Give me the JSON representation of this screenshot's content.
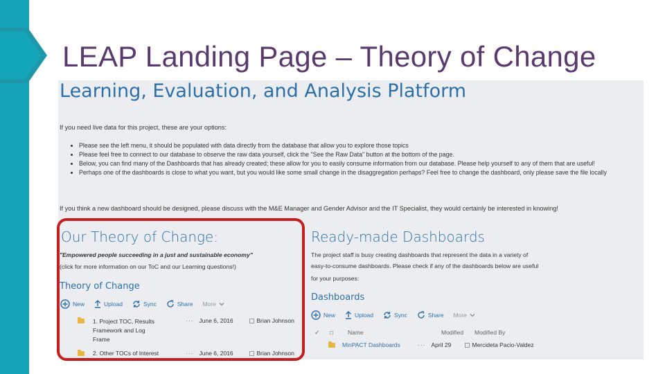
{
  "slide": {
    "title": "LEAP Landing Page – Theory of Change",
    "accent_color": "#14a3b5",
    "title_color": "#5a3a6e",
    "highlight_color": "#c41e1e"
  },
  "page": {
    "platform_title": "Learning, Evaluation, and Analysis Platform",
    "intro": "If you need live data for this project, these are your options:",
    "options": [
      "Please see the left menu, it should be populated with data directly from the database that allow you to explore those topics",
      "Please feel free to connect to our database to observe the raw data yourself, click the \"See the Raw Data\" button at the bottom of the page.",
      "Below, you can find many of the Dashboards that has already created; these allow for you to easily consume information from our database. Please help yourself to any of them that are useful!",
      "Perhaps one of the dashboards is close to what you want, but you would like some small change in the disaggregation perhaps? Feel free to change the dashboard, only please save the file locally"
    ],
    "note": "If you think a new dashboard should be designed, please discuss with the M&E Manager and Gender Advisor and the IT Specialist, they would certainly be interested in knowing!"
  },
  "toc": {
    "heading": "Our Theory of Change:",
    "quote": "\"Empowered people succeeding in a just and sustainable economy\"",
    "more_info": "(click for more information on our ToC and our Learning questions!)",
    "library_title": "Theory of Change",
    "toolbar": {
      "new": "New",
      "upload": "Upload",
      "sync": "Sync",
      "share": "Share",
      "more": "More"
    },
    "files": [
      {
        "name_line1": "1. Project TOC, Results",
        "name_line2": "Framework and Log",
        "name_line3": "Frame",
        "modified": "June 6, 2016",
        "modified_by": "Brian Johnson"
      },
      {
        "name_line1": "2. Other TOCs of Interest",
        "modified": "June 6, 2016",
        "modified_by": "Brian Johnson"
      }
    ]
  },
  "dashboards": {
    "heading": "Ready-made Dashboards",
    "desc_line1": "The project staff is busy creating dashboards that represent the data in a variety of",
    "desc_line2": "easy-to-consume dashboards. Please check if any of the dashboards below are useful",
    "desc_line3": "for your purposes:",
    "library_title": "Dashboards",
    "toolbar": {
      "new": "New",
      "upload": "Upload",
      "sync": "Sync",
      "share": "Share",
      "more": "More"
    },
    "columns": {
      "name": "Name",
      "modified": "Modified",
      "modified_by": "Modified By"
    },
    "files": [
      {
        "name": "MinPACT Dashboards",
        "modified": "April 29",
        "modified_by": "Mercideta Pacio-Valdez"
      }
    ]
  }
}
